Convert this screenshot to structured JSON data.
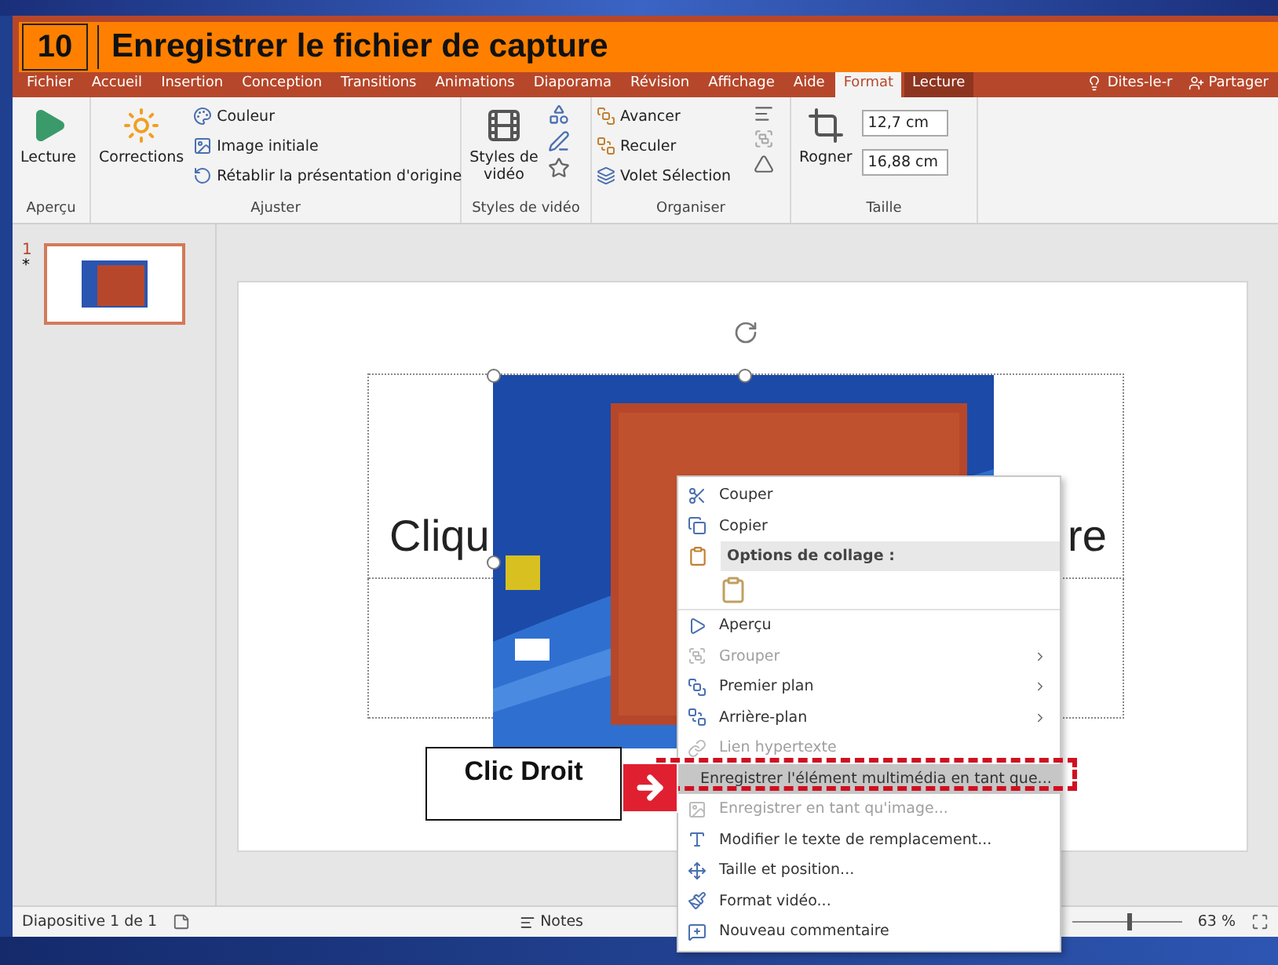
{
  "banner": {
    "step": "10",
    "title": "Enregistrer le fichier de capture"
  },
  "tabs": [
    {
      "label": "Fichier",
      "selected": false,
      "contextual": false
    },
    {
      "label": "Accueil",
      "selected": false,
      "contextual": false
    },
    {
      "label": "Insertion",
      "selected": false,
      "contextual": false
    },
    {
      "label": "Conception",
      "selected": false,
      "contextual": false
    },
    {
      "label": "Transitions",
      "selected": false,
      "contextual": false
    },
    {
      "label": "Animations",
      "selected": false,
      "contextual": false
    },
    {
      "label": "Diaporama",
      "selected": false,
      "contextual": false
    },
    {
      "label": "Révision",
      "selected": false,
      "contextual": false
    },
    {
      "label": "Affichage",
      "selected": false,
      "contextual": false
    },
    {
      "label": "Aide",
      "selected": false,
      "contextual": false
    },
    {
      "label": "Format",
      "selected": true,
      "contextual": true
    },
    {
      "label": "Lecture",
      "selected": false,
      "contextual": true
    }
  ],
  "tell_me": "Dites-le-r",
  "share": "Partager",
  "ribbon": {
    "preview": {
      "label": "Aperçu",
      "play": "Lecture"
    },
    "adjust": {
      "label": "Ajuster",
      "corrections": "Corrections",
      "tint": "Couleur",
      "initial_image": "Image initiale",
      "reset": "Rétablir la présentation d'origine"
    },
    "video_styles": {
      "label": "Styles de vidéo",
      "styles": "Styles de vidéo"
    },
    "arrange": {
      "label": "Organiser",
      "forward": "Avancer",
      "backward": "Reculer",
      "selection_pane": "Volet Sélection"
    },
    "size": {
      "label": "Taille",
      "crop": "Rogner",
      "height": "12,7 cm",
      "width": "16,88 cm"
    }
  },
  "thumbnails": [
    {
      "number": "1",
      "mark": "*",
      "selected": true
    }
  ],
  "slide": {
    "title_left": "Cliqu",
    "title_right": "re"
  },
  "context_menu": [
    {
      "kind": "item",
      "label": "Couper",
      "disabled": false,
      "submenu": false,
      "highlighted": false
    },
    {
      "kind": "item",
      "label": "Copier",
      "disabled": false,
      "submenu": false,
      "highlighted": false
    },
    {
      "kind": "header",
      "label": "Options de collage :"
    },
    {
      "kind": "paste"
    },
    {
      "kind": "item",
      "label": "Aperçu",
      "disabled": false,
      "submenu": false,
      "highlighted": false
    },
    {
      "kind": "item",
      "label": "Grouper",
      "disabled": true,
      "submenu": true,
      "highlighted": false
    },
    {
      "kind": "item",
      "label": "Premier plan",
      "disabled": false,
      "submenu": true,
      "highlighted": false
    },
    {
      "kind": "item",
      "label": "Arrière-plan",
      "disabled": false,
      "submenu": true,
      "highlighted": false
    },
    {
      "kind": "item",
      "label": "Lien hypertexte",
      "disabled": true,
      "submenu": false,
      "highlighted": false
    },
    {
      "kind": "item",
      "label": "Enregistrer l'élément multimédia en tant que...",
      "disabled": false,
      "submenu": false,
      "highlighted": true
    },
    {
      "kind": "item",
      "label": "Enregistrer en tant qu'image...",
      "disabled": true,
      "submenu": false,
      "highlighted": false
    },
    {
      "kind": "item",
      "label": "Modifier le texte de remplacement...",
      "disabled": false,
      "submenu": false,
      "highlighted": false
    },
    {
      "kind": "item",
      "label": "Taille et position...",
      "disabled": false,
      "submenu": false,
      "highlighted": false
    },
    {
      "kind": "item",
      "label": "Format vidéo...",
      "disabled": false,
      "submenu": false,
      "highlighted": false
    },
    {
      "kind": "item",
      "label": "Nouveau commentaire",
      "disabled": false,
      "submenu": false,
      "highlighted": false
    }
  ],
  "callout": "Clic Droit",
  "status_bar": {
    "slide": "Diapositive 1 de 1",
    "notes": "Notes",
    "zoom": "63 %",
    "level": 0.5
  }
}
